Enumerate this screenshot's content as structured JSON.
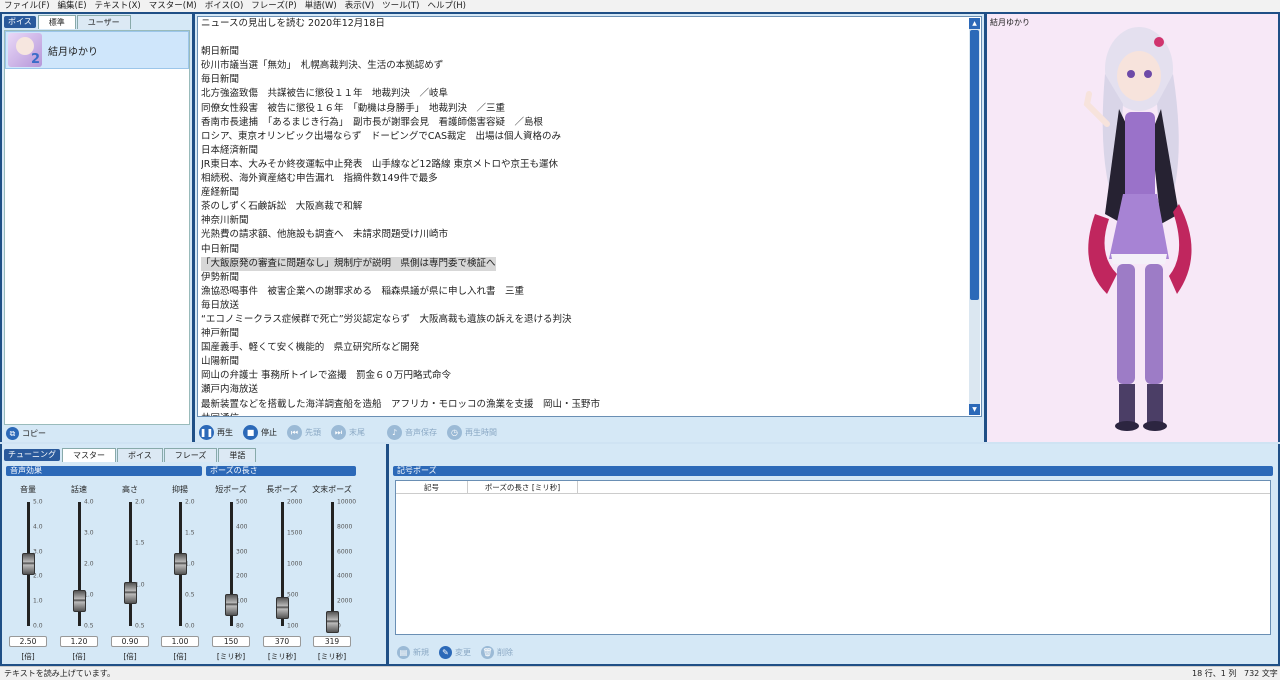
{
  "menu": [
    "ファイル(F)",
    "編集(E)",
    "テキスト(X)",
    "マスター(M)",
    "ボイス(O)",
    "フレーズ(P)",
    "単語(W)",
    "表示(V)",
    "ツール(T)",
    "ヘルプ(H)"
  ],
  "voice_panel": {
    "label": "ボイス",
    "tabs": [
      "標準",
      "ユーザー"
    ],
    "items": [
      {
        "name": "結月ゆかり"
      }
    ],
    "copy_label": "コピー"
  },
  "text_lines": [
    "ニュースの見出しを読む 2020年12月18日",
    "",
    "朝日新聞",
    "砂川市議当選「無効」　札幌高裁判決、生活の本拠認めず",
    "毎日新聞",
    "北方強盗致傷　共謀被告に懲役１１年　地裁判決　／岐阜",
    "同僚女性殺害　被告に懲役１６年　「動機は身勝手」　地裁判決　／三重",
    "香南市長逮捕　「あるまじき行為」　副市長が謝罪会見　看護師傷害容疑　／島根",
    "ロシア、東京オリンピック出場ならず　ドーピングでCAS裁定　出場は個人資格のみ",
    "日本経済新聞",
    "JR東日本、大みそか終夜運転中止発表　山手線など12路線 東京メトロや京王も運休",
    "相続税、海外資産絡む申告漏れ　指摘件数149件で最多",
    "産経新聞",
    "茶のしずく石鹸訴訟　大阪高裁で和解",
    "神奈川新聞",
    "光熱費の請求額、他施設も調査へ　未請求問題受け川崎市",
    "中日新聞",
    "「大飯原発の審査に問題なし」規制庁が説明　県側は専門委で検証へ",
    "伊勢新聞",
    "漁協恐喝事件　被害企業への謝罪求める　稲森県議が県に申し入れ書　三重",
    "毎日放送",
    "“エコノミークラス症候群で死亡”労災認定ならず　大阪高裁も遺族の訴えを退ける判決",
    "神戸新聞",
    "国産義手、軽くて安く機能的　県立研究所など開発",
    "山陽新聞",
    "岡山の弁護士 事務所トイレで盗撮　罰金６０万円略式命令",
    "瀬戸内海放送",
    "最新装置などを搭載した海洋調査船を造船　アフリカ・モロッコの漁業を支援　岡山・玉野市",
    "共同通信"
  ],
  "selected_line": 17,
  "playback": {
    "play": "再生",
    "stop": "停止",
    "head": "先頭",
    "end": "末尾",
    "save": "音声保存",
    "time": "再生時間"
  },
  "character": {
    "name": "結月ゆかり"
  },
  "tuning": {
    "label": "チューニング",
    "tabs": [
      "マスター",
      "ボイス",
      "フレーズ",
      "単語"
    ],
    "section_effects": "音声効果",
    "section_pause": "ポーズの長さ"
  },
  "sliders": [
    {
      "label": "音量",
      "value": "2.50",
      "unit": "[倍]",
      "min": 0,
      "max": 5,
      "v": 2.5,
      "ticks": [
        "5.0",
        "4.0",
        "3.0",
        "2.0",
        "1.0",
        "0.0"
      ]
    },
    {
      "label": "話速",
      "value": "1.20",
      "unit": "[倍]",
      "min": 0.5,
      "max": 4,
      "v": 1.2,
      "ticks": [
        "4.0",
        "3.0",
        "2.0",
        "1.0",
        "0.5"
      ]
    },
    {
      "label": "高さ",
      "value": "0.90",
      "unit": "[倍]",
      "min": 0.5,
      "max": 2,
      "v": 0.9,
      "ticks": [
        "2.0",
        "1.5",
        "1.0",
        "0.5"
      ]
    },
    {
      "label": "抑揚",
      "value": "1.00",
      "unit": "[倍]",
      "min": 0,
      "max": 2,
      "v": 1.0,
      "ticks": [
        "2.0",
        "1.5",
        "1.0",
        "0.5",
        "0.0"
      ]
    },
    {
      "label": "短ポーズ",
      "value": "150",
      "unit": "[ミリ秒]",
      "min": 80,
      "max": 500,
      "v": 150,
      "ticks": [
        "500",
        "400",
        "300",
        "200",
        "100",
        "80"
      ]
    },
    {
      "label": "長ポーズ",
      "value": "370",
      "unit": "[ミリ秒]",
      "min": 100,
      "max": 2000,
      "v": 370,
      "ticks": [
        "2000",
        "1500",
        "1000",
        "500",
        "100"
      ]
    },
    {
      "label": "文末ポーズ",
      "value": "319",
      "unit": "[ミリ秒]",
      "min": 0,
      "max": 10000,
      "v": 319,
      "ticks": [
        "10000",
        "8000",
        "6000",
        "4000",
        "2000",
        "0"
      ]
    }
  ],
  "pause_panel": {
    "title": "記号ポーズ",
    "col_symbol": "記号",
    "col_length": "ポーズの長さ [ミリ秒]",
    "btn_new": "新規",
    "btn_edit": "変更",
    "btn_delete": "削除"
  },
  "status": {
    "message": "テキストを読み上げています。",
    "position": "18 行、1 列",
    "count": "732 文字"
  }
}
